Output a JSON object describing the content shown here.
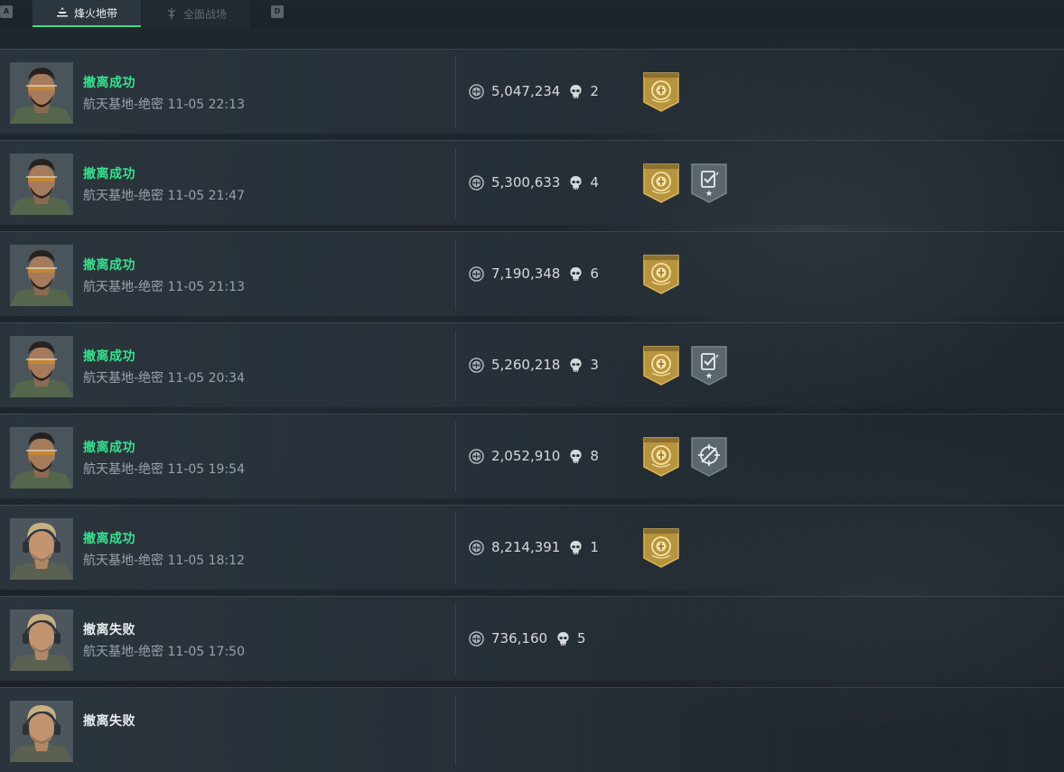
{
  "topbar": {
    "key_left": "A",
    "key_right": "D",
    "tabs": [
      {
        "label": "烽火地带",
        "active": true,
        "icon": "operations-icon"
      },
      {
        "label": "全面战场",
        "active": false,
        "icon": "warfare-icon"
      }
    ]
  },
  "colors": {
    "success": "#36e38f",
    "fail": "#e8ecef",
    "gold_badge": "#b8943e",
    "grey_badge": "#5c666d"
  },
  "records": [
    {
      "status": "撤离成功",
      "success": true,
      "map": "航天基地-绝密",
      "time": "11-05 22:13",
      "value": "5,047,234",
      "kills": "2",
      "avatar": "operator-goggles",
      "badges": [
        "gold-emblem-badge"
      ]
    },
    {
      "status": "撤离成功",
      "success": true,
      "map": "航天基地-绝密",
      "time": "11-05 21:47",
      "value": "5,300,633",
      "kills": "4",
      "avatar": "operator-goggles",
      "badges": [
        "gold-emblem-badge",
        "task-complete-badge"
      ]
    },
    {
      "status": "撤离成功",
      "success": true,
      "map": "航天基地-绝密",
      "time": "11-05 21:13",
      "value": "7,190,348",
      "kills": "6",
      "avatar": "operator-goggles",
      "badges": [
        "gold-emblem-badge"
      ]
    },
    {
      "status": "撤离成功",
      "success": true,
      "map": "航天基地-绝密",
      "time": "11-05 20:34",
      "value": "5,260,218",
      "kills": "3",
      "avatar": "operator-goggles",
      "badges": [
        "gold-emblem-badge",
        "task-complete-badge"
      ]
    },
    {
      "status": "撤离成功",
      "success": true,
      "map": "航天基地-绝密",
      "time": "11-05 19:54",
      "value": "2,052,910",
      "kills": "8",
      "avatar": "operator-goggles",
      "badges": [
        "gold-emblem-badge",
        "crosshair-badge"
      ]
    },
    {
      "status": "撤离成功",
      "success": true,
      "map": "航天基地-绝密",
      "time": "11-05 18:12",
      "value": "8,214,391",
      "kills": "1",
      "avatar": "operator-headset",
      "badges": [
        "gold-emblem-badge"
      ]
    },
    {
      "status": "撤离失败",
      "success": false,
      "map": "航天基地-绝密",
      "time": "11-05 17:50",
      "value": "736,160",
      "kills": "5",
      "avatar": "operator-headset",
      "badges": []
    },
    {
      "status": "撤离失败",
      "success": false,
      "map": "",
      "time": "",
      "value": "",
      "kills": "",
      "avatar": "operator-headset",
      "badges": []
    }
  ]
}
